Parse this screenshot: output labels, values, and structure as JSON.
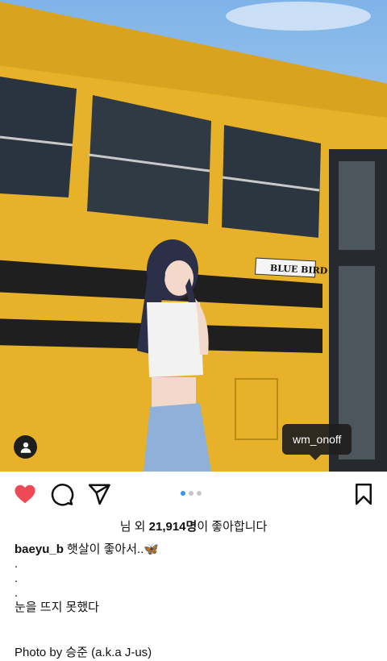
{
  "post": {
    "tagged_user": "wm_onoff",
    "like_prefix": "님 외 ",
    "like_count": "21,914명",
    "like_suffix": "이 좋아합니다",
    "author": "baeyu_b",
    "caption_first": " 햇살이 좋아서..",
    "caption_emoji": "🦋",
    "dot1": ".",
    "dot2": ".",
    "dot3": ".",
    "caption_last": "눈을 뜨지 못했다",
    "credit": "Photo by 승준 (a.k.a J-us)",
    "carousel_count": 3,
    "carousel_active": 1,
    "liked": true
  },
  "photo_scene": {
    "bus_sign": "BLUE BIRD"
  },
  "colors": {
    "heart": "#ed4956",
    "active_dot": "#3897f0",
    "bus_yellow": "#e8b12a"
  },
  "icons": {
    "like": "heart-icon",
    "comment": "comment-icon",
    "share": "send-icon",
    "save": "bookmark-icon",
    "tags": "person-icon"
  }
}
